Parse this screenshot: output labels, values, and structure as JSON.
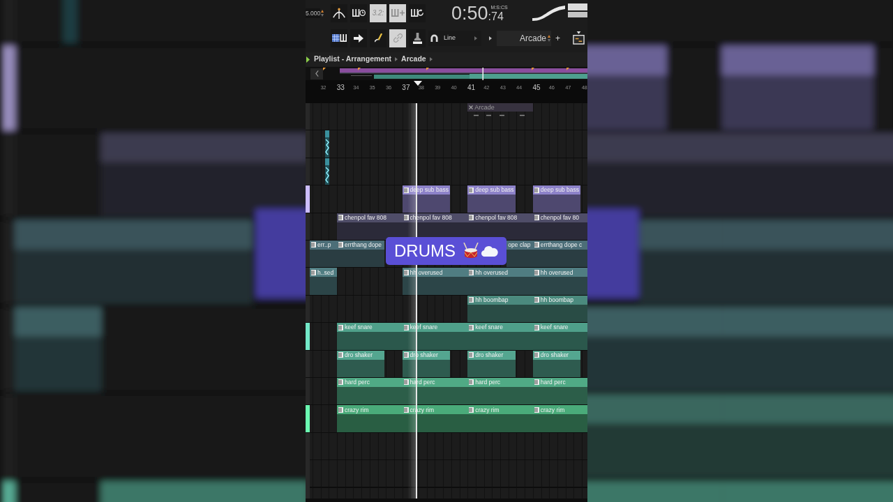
{
  "transport": {
    "readout": "5.000",
    "buttons": [
      {
        "kind": "icon",
        "selected": false
      },
      {
        "kind": "icon",
        "selected": false
      },
      {
        "kind": "text",
        "label": "3.2:",
        "selected": true
      },
      {
        "kind": "icon",
        "selected": true
      },
      {
        "kind": "icon",
        "selected": false
      }
    ],
    "time": {
      "main": "0:50",
      "fraction": ":74",
      "unit": "M:S:CS"
    }
  },
  "tools": {
    "buttons": [
      {
        "selected": false
      },
      {
        "selected": false
      },
      {
        "selected": false
      },
      {
        "selected": true
      },
      {
        "selected": false
      }
    ],
    "snap": {
      "value": "Line"
    },
    "pattern": {
      "value": "Arcade"
    },
    "add": "+"
  },
  "playlist": {
    "breadcrumb": [
      "Playlist - Arrangement",
      "Arcade"
    ],
    "ruler": [
      {
        "label": "32",
        "kind": "minor"
      },
      {
        "label": "33",
        "kind": "major"
      },
      {
        "label": "34",
        "kind": "minor"
      },
      {
        "label": "35",
        "kind": "minor"
      },
      {
        "label": "36",
        "kind": "minor"
      },
      {
        "label": "37",
        "kind": "major"
      },
      {
        "label": "38",
        "kind": "minor"
      },
      {
        "label": "39",
        "kind": "minor"
      },
      {
        "label": "40",
        "kind": "minor"
      },
      {
        "label": "41",
        "kind": "major"
      },
      {
        "label": "42",
        "kind": "minor"
      },
      {
        "label": "43",
        "kind": "minor"
      },
      {
        "label": "44",
        "kind": "minor"
      },
      {
        "label": "45",
        "kind": "major"
      },
      {
        "label": "46",
        "kind": "minor"
      },
      {
        "label": "47",
        "kind": "minor"
      },
      {
        "label": "48",
        "kind": "minor"
      }
    ],
    "tracks": [
      {
        "color": "#37323f",
        "lit_strip": false,
        "clips": [
          {
            "kind": "gap"
          },
          {
            "kind": "gap"
          },
          {
            "kind": "gap"
          },
          {
            "kind": "muted",
            "label": "Arcade"
          }
        ]
      },
      {
        "color": "#3a8f9c",
        "lit_strip": false,
        "clips": [
          {
            "kind": "audio"
          }
        ]
      },
      {
        "color": "#3a8f9c",
        "lit_strip": false,
        "clips": [
          {
            "kind": "audio"
          }
        ]
      },
      {
        "color": "#8d82c9",
        "lit_strip": true,
        "clips": [
          {
            "kind": "gap"
          },
          {
            "kind": "gap"
          },
          {
            "kind": "short",
            "label": "deep sub bass"
          },
          {
            "kind": "short",
            "label": "deep sub bass"
          },
          {
            "kind": "short",
            "label": "deep sub bass"
          }
        ]
      },
      {
        "color": "#4f4d68",
        "lit_strip": false,
        "clips": [
          {
            "kind": "gap"
          },
          {
            "kind": "full",
            "label": "chenpol fav 808"
          },
          {
            "kind": "full",
            "label": "chenpol fav 808"
          },
          {
            "kind": "full",
            "label": "chenpol fav 808"
          },
          {
            "kind": "full",
            "label": "chenpol fav 80"
          }
        ]
      },
      {
        "color": "#4c6e78",
        "lit_strip": false,
        "clips": [
          {
            "kind": "full",
            "label": "err..p"
          },
          {
            "kind": "short",
            "label": "errthang dope"
          },
          {
            "kind": "gap"
          },
          {
            "kind": "tail",
            "label": "ope clap"
          },
          {
            "kind": "full",
            "label": "errthang dope c"
          }
        ]
      },
      {
        "color": "#507d82",
        "lit_strip": false,
        "clips": [
          {
            "kind": "full",
            "label": "h..sed"
          },
          {
            "kind": "gap"
          },
          {
            "kind": "full",
            "label": "hh overused"
          },
          {
            "kind": "full",
            "label": "hh overused"
          },
          {
            "kind": "full",
            "label": "hh overused"
          }
        ]
      },
      {
        "color": "#4b8a7e",
        "lit_strip": false,
        "clips": [
          {
            "kind": "gap"
          },
          {
            "kind": "gap"
          },
          {
            "kind": "gap"
          },
          {
            "kind": "full",
            "label": "hh boombap"
          },
          {
            "kind": "full",
            "label": "hh boombap"
          }
        ]
      },
      {
        "color": "#4fa08a",
        "lit_strip": true,
        "clips": [
          {
            "kind": "gap"
          },
          {
            "kind": "full",
            "label": "keef snare"
          },
          {
            "kind": "full",
            "label": "keef snare"
          },
          {
            "kind": "full",
            "label": "keef snare"
          },
          {
            "kind": "full",
            "label": "keef snare"
          }
        ]
      },
      {
        "color": "#54a690",
        "lit_strip": false,
        "clips": [
          {
            "kind": "gap"
          },
          {
            "kind": "short",
            "label": "dro shaker"
          },
          {
            "kind": "short",
            "label": "dro shaker"
          },
          {
            "kind": "short",
            "label": "dro shaker"
          },
          {
            "kind": "short",
            "label": "dro shaker"
          }
        ]
      },
      {
        "color": "#50aa85",
        "lit_strip": false,
        "clips": [
          {
            "kind": "gap"
          },
          {
            "kind": "full",
            "label": "hard perc"
          },
          {
            "kind": "full",
            "label": "hard perc"
          },
          {
            "kind": "full",
            "label": "hard perc"
          },
          {
            "kind": "full",
            "label": "hard perc"
          }
        ]
      },
      {
        "color": "#4aab7a",
        "lit_strip": true,
        "clips": [
          {
            "kind": "gap"
          },
          {
            "kind": "full",
            "label": "crazy rim"
          },
          {
            "kind": "full",
            "label": "crazy rim"
          },
          {
            "kind": "full",
            "label": "crazy rim"
          },
          {
            "kind": "full",
            "label": "crazy rim"
          }
        ]
      }
    ],
    "caption": {
      "text": "DRUMS"
    }
  }
}
